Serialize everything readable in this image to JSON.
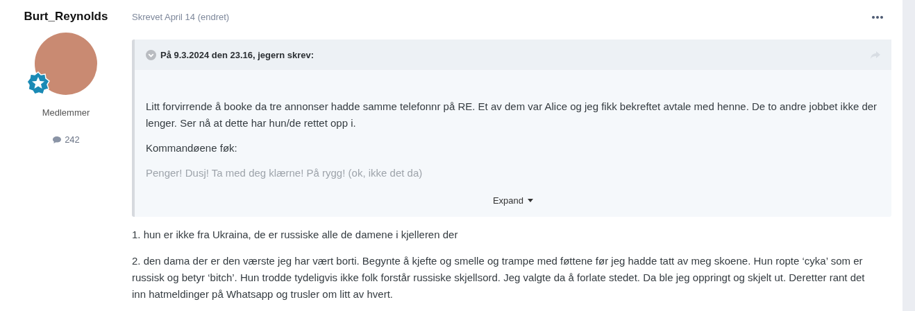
{
  "author": {
    "name": "Burt_Reynolds",
    "group": "Medlemmer",
    "post_count": "242"
  },
  "post": {
    "meta": "Skrevet April 14 (endret)",
    "quote": {
      "citation": "På 9.3.2024 den 23.16, jegern skrev:",
      "expanded": false,
      "paragraphs": [
        {
          "text": "Litt forvirrende å booke da tre annonser hadde samme telefonnr på RE. Et av dem var Alice og jeg fikk bekreftet avtale med henne. De to andre jobbet ikke der lenger. Ser nå at dette har hun/de rettet opp i.",
          "faded": false
        },
        {
          "text": "Kommandøene føk:",
          "faded": false
        },
        {
          "text": "Penger! Dusj! Ta med deg klærne! På rygg! (ok, ikke det da)",
          "faded": true
        }
      ],
      "expand_label": "Expand"
    },
    "paragraphs": [
      "1. hun er ikke fra Ukraina, de er russiske alle de damene i kjelleren der",
      "2. den dama der er den værste jeg har vært borti. Begynte å kjefte og smelle og trampe med føttene før jeg hadde tatt av meg skoene. Hun ropte ‘cyka’ som er russisk og betyr ‘bitch’. Hun trodde tydeligvis ikke folk forstår russiske skjellsord. Jeg valgte da å forlate stedet. Da ble jeg oppringt og skjelt ut. Deretter rant det inn hatmeldinger på Whatsapp og trusler om litt av hvert."
    ]
  }
}
